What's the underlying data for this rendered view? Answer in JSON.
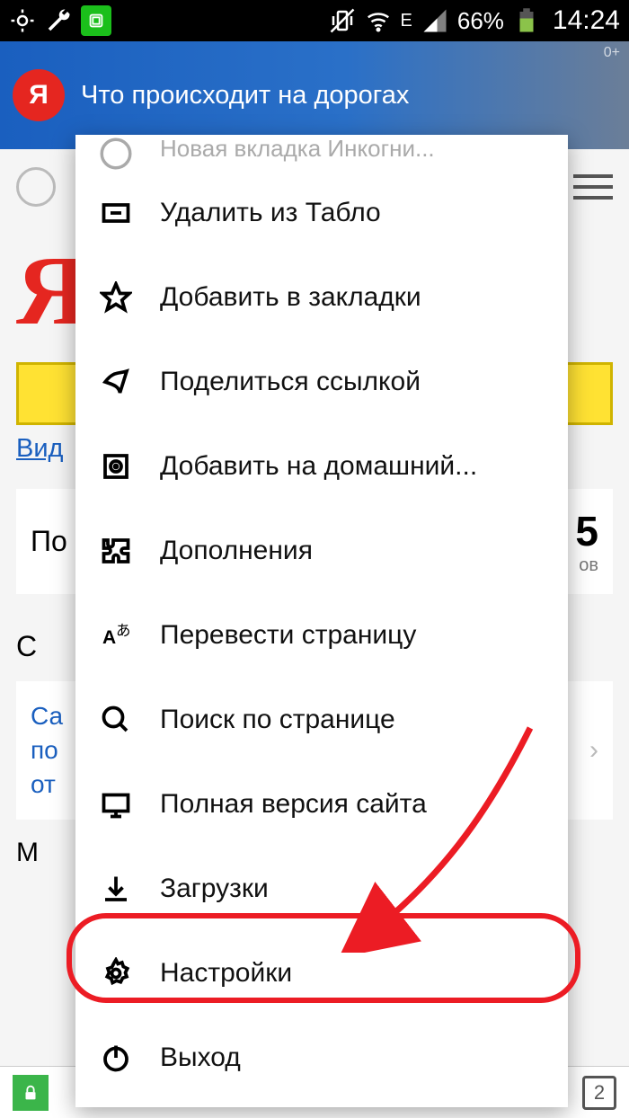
{
  "statusbar": {
    "battery_pct": "66%",
    "time": "14:24",
    "network_label": "E"
  },
  "banner": {
    "logo_letter": "Я",
    "text": "Что происходит на дорогах",
    "age": "0+"
  },
  "page": {
    "logo": "Я",
    "vid_link": "Вид",
    "po_label": "По",
    "five": "5",
    "five_sub": "ов",
    "section_title": "С",
    "links_line1": "Са",
    "links_line2": "по",
    "links_line3": "от",
    "m_line": "М"
  },
  "menu": {
    "top_cut": "Новая вкладка Инкогни...",
    "items": [
      {
        "label": "Удалить из Табло"
      },
      {
        "label": "Добавить в закладки"
      },
      {
        "label": "Поделиться ссылкой"
      },
      {
        "label": "Добавить на домашний..."
      },
      {
        "label": "Дополнения"
      },
      {
        "label": "Перевести страницу"
      },
      {
        "label": "Поиск по странице"
      },
      {
        "label": "Полная версия сайта"
      },
      {
        "label": "Загрузки"
      },
      {
        "label": "Настройки"
      },
      {
        "label": "Выход"
      }
    ]
  },
  "bottombar": {
    "tab_count": "2"
  }
}
